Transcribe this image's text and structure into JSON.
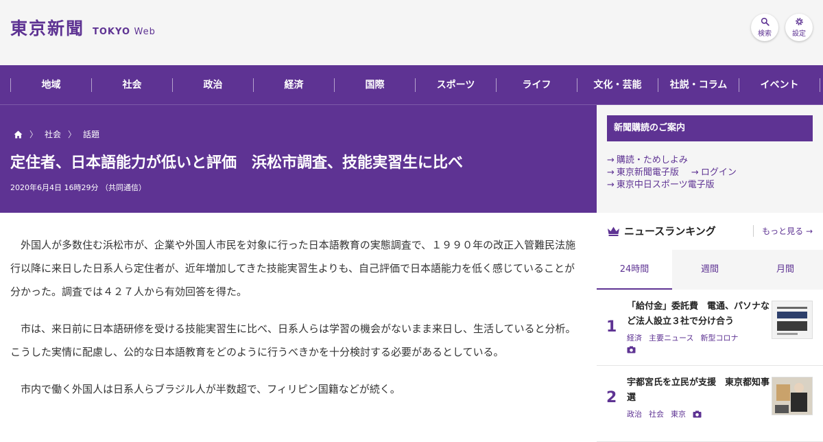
{
  "header": {
    "logo_jp": "東京新聞",
    "logo_en_bold": "TOKYO",
    "logo_en_light": "Web",
    "search_label": "検索",
    "settings_label": "設定"
  },
  "nav": [
    "地域",
    "社会",
    "政治",
    "経済",
    "国際",
    "スポーツ",
    "ライフ",
    "文化・芸能",
    "社説・コラム",
    "イベント"
  ],
  "breadcrumb": [
    "社会",
    "話題"
  ],
  "article": {
    "title": "定住者、日本語能力が低いと評価　浜松市調査、技能実習生に比べ",
    "date": "2020年6月4日 16時29分 （共同通信）",
    "paragraphs": [
      "　外国人が多数住む浜松市が、企業や外国人市民を対象に行った日本語教育の実態調査で、１９９０年の改正入管難民法施行以降に来日した日系人ら定住者が、近年増加してきた技能実習生よりも、自己評価で日本語能力を低く感じていることが分かった。調査では４２７人から有効回答を得た。",
      "　市は、来日前に日本語研修を受ける技能実習生に比べ、日系人らは学習の機会がないまま来日し、生活していると分析。こうした実情に配慮し、公的な日本語教育をどのように行うべきかを十分検討する必要があるとしている。",
      "　市内で働く外国人は日系人らブラジル人が半数超で、フィリピン国籍などが続く。"
    ]
  },
  "subscription": {
    "heading": "新聞購読のご案内",
    "links": [
      "購読・ためしよみ",
      "東京新聞電子版",
      "ログイン",
      "東京中日スポーツ電子版"
    ]
  },
  "ranking": {
    "title": "ニュースランキング",
    "more": "もっと見る",
    "tabs": [
      "24時間",
      "週間",
      "月間"
    ],
    "items": [
      {
        "rank": "1",
        "title": "「給付金」委託費　電通、パソナなど法人設立３社で分け合う",
        "tags": [
          "経済",
          "主要ニュース",
          "新型コロナ"
        ]
      },
      {
        "rank": "2",
        "title": "宇都宮氏を立民が支援　東京都知事選",
        "tags": [
          "政治",
          "社会",
          "東京"
        ]
      }
    ]
  },
  "colors": {
    "brand": "#5e3393",
    "background": "#f5f5f5"
  }
}
